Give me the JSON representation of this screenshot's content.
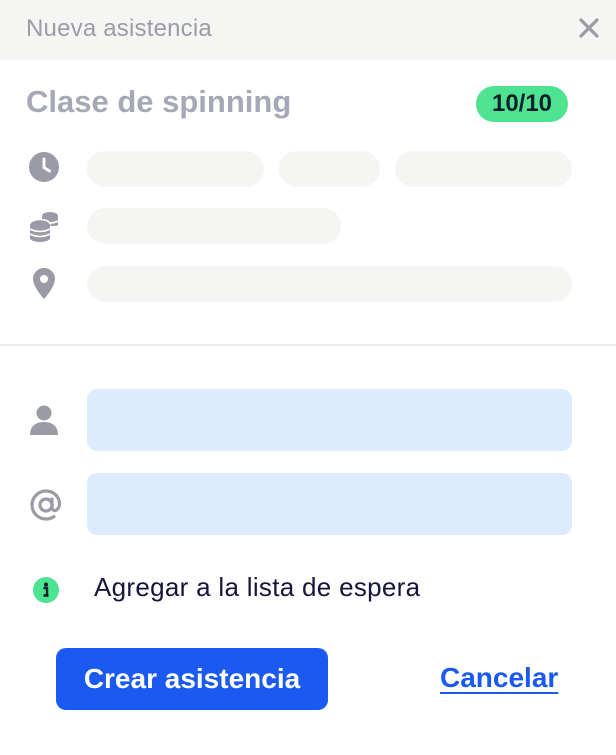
{
  "header": {
    "title": "Nueva asistencia",
    "close_icon": "close-icon"
  },
  "event": {
    "title": "Clase de spinning",
    "capacity": "10/10"
  },
  "icons": {
    "time": "clock-icon",
    "price": "coins-icon",
    "location": "location-pin-icon",
    "name": "user-icon",
    "email": "at-sign-icon",
    "info": "info-icon"
  },
  "form": {
    "name_value": "",
    "email_value": ""
  },
  "waitlist": {
    "label": "Agregar a la lista de espera"
  },
  "actions": {
    "create_label": "Crear asistencia",
    "cancel_label": "Cancelar"
  },
  "colors": {
    "primary": "#1a5af0",
    "badge": "#4de391",
    "field_bg": "#dcebfd",
    "icon_gray": "#9a9ba6"
  }
}
